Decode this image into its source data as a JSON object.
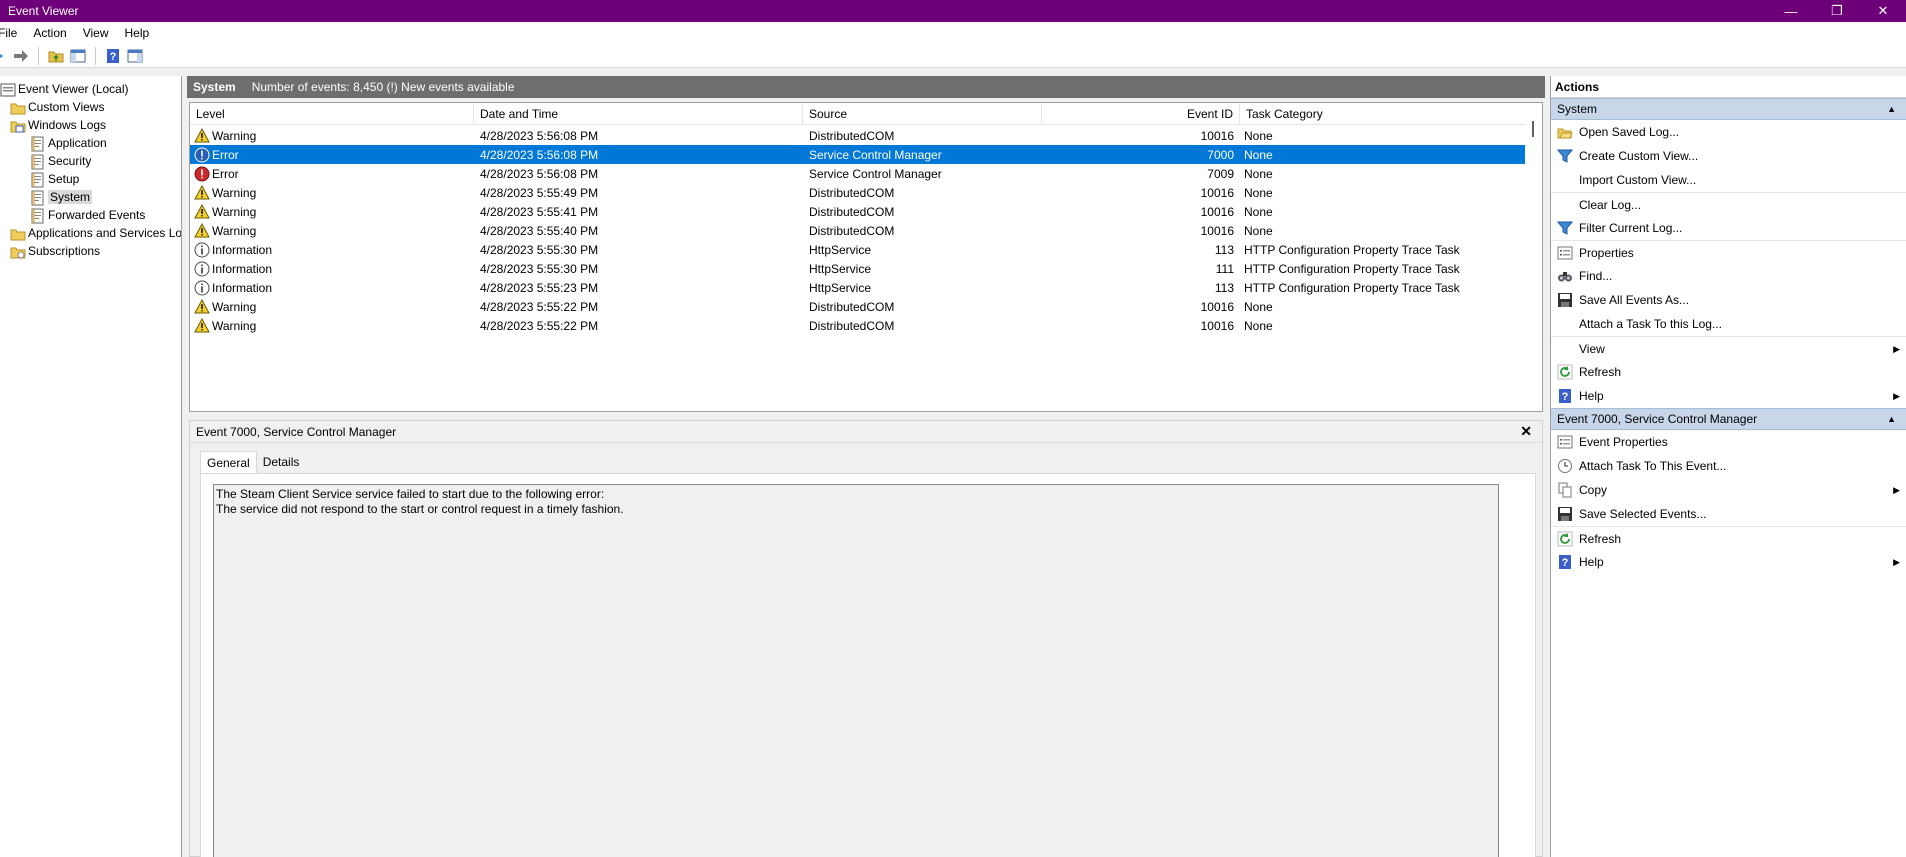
{
  "window": {
    "title": "Event Viewer",
    "min_glyph": "—",
    "max_glyph": "❐",
    "close_glyph": "✕"
  },
  "menu": [
    "File",
    "Action",
    "View",
    "Help"
  ],
  "tree": [
    {
      "label": "Event Viewer (Local)",
      "icon": "event-viewer-icon",
      "indent": 0
    },
    {
      "label": "Custom Views",
      "icon": "folder-icon",
      "indent": 1
    },
    {
      "label": "Windows Logs",
      "icon": "windows-logs-icon",
      "indent": 1
    },
    {
      "label": "Application",
      "icon": "log-icon",
      "indent": 2
    },
    {
      "label": "Security",
      "icon": "log-icon",
      "indent": 2
    },
    {
      "label": "Setup",
      "icon": "log-icon",
      "indent": 2
    },
    {
      "label": "System",
      "icon": "log-icon",
      "indent": 2,
      "selected": true
    },
    {
      "label": "Forwarded Events",
      "icon": "log-icon",
      "indent": 2
    },
    {
      "label": "Applications and Services Lo",
      "icon": "folder-icon",
      "indent": 1
    },
    {
      "label": "Subscriptions",
      "icon": "subscriptions-icon",
      "indent": 1
    }
  ],
  "log_header": {
    "title": "System",
    "info": "Number of events: 8,450 (!) New events available"
  },
  "columns": {
    "level": "Level",
    "date": "Date and Time",
    "source": "Source",
    "event_id": "Event ID",
    "task_category": "Task Category"
  },
  "events": [
    {
      "level": "Warning",
      "date": "4/28/2023 5:56:08 PM",
      "source": "DistributedCOM",
      "event_id": "10016",
      "category": "None"
    },
    {
      "level": "Error",
      "date": "4/28/2023 5:56:08 PM",
      "source": "Service Control Manager",
      "event_id": "7000",
      "category": "None",
      "selected": true
    },
    {
      "level": "Error",
      "date": "4/28/2023 5:56:08 PM",
      "source": "Service Control Manager",
      "event_id": "7009",
      "category": "None"
    },
    {
      "level": "Warning",
      "date": "4/28/2023 5:55:49 PM",
      "source": "DistributedCOM",
      "event_id": "10016",
      "category": "None"
    },
    {
      "level": "Warning",
      "date": "4/28/2023 5:55:41 PM",
      "source": "DistributedCOM",
      "event_id": "10016",
      "category": "None"
    },
    {
      "level": "Warning",
      "date": "4/28/2023 5:55:40 PM",
      "source": "DistributedCOM",
      "event_id": "10016",
      "category": "None"
    },
    {
      "level": "Information",
      "date": "4/28/2023 5:55:30 PM",
      "source": "HttpService",
      "event_id": "113",
      "category": "HTTP Configuration Property Trace Task"
    },
    {
      "level": "Information",
      "date": "4/28/2023 5:55:30 PM",
      "source": "HttpService",
      "event_id": "111",
      "category": "HTTP Configuration Property Trace Task"
    },
    {
      "level": "Information",
      "date": "4/28/2023 5:55:23 PM",
      "source": "HttpService",
      "event_id": "113",
      "category": "HTTP Configuration Property Trace Task"
    },
    {
      "level": "Warning",
      "date": "4/28/2023 5:55:22 PM",
      "source": "DistributedCOM",
      "event_id": "10016",
      "category": "None"
    },
    {
      "level": "Warning",
      "date": "4/28/2023 5:55:22 PM",
      "source": "DistributedCOM",
      "event_id": "10016",
      "category": "None"
    }
  ],
  "detail": {
    "title": "Event 7000, Service Control Manager",
    "close_glyph": "✕",
    "tabs": [
      "General",
      "Details"
    ],
    "description": [
      "The Steam Client Service service failed to start due to the following error:",
      "The service did not respond to the start or control request in a timely fashion."
    ]
  },
  "actions": {
    "title": "Actions",
    "sections": [
      {
        "title": "System",
        "items": [
          {
            "label": "Open Saved Log...",
            "icon": "open-folder-icon"
          },
          {
            "label": "Create Custom View...",
            "icon": "filter-icon"
          },
          {
            "label": "Import Custom View...",
            "icon": ""
          },
          {
            "label": "Clear Log...",
            "icon": "",
            "sep": true
          },
          {
            "label": "Filter Current Log...",
            "icon": "filter-icon"
          },
          {
            "label": "Properties",
            "icon": "properties-icon",
            "sep": true
          },
          {
            "label": "Find...",
            "icon": "binoculars-icon"
          },
          {
            "label": "Save All Events As...",
            "icon": "save-icon"
          },
          {
            "label": "Attach a Task To this Log...",
            "icon": ""
          },
          {
            "label": "View",
            "icon": "",
            "submenu": true,
            "sep": true
          },
          {
            "label": "Refresh",
            "icon": "refresh-icon"
          },
          {
            "label": "Help",
            "icon": "help-icon",
            "submenu": true
          }
        ]
      },
      {
        "title": "Event 7000, Service Control Manager",
        "items": [
          {
            "label": "Event Properties",
            "icon": "properties-icon"
          },
          {
            "label": "Attach Task To This Event...",
            "icon": "task-icon"
          },
          {
            "label": "Copy",
            "icon": "copy-icon",
            "submenu": true
          },
          {
            "label": "Save Selected Events...",
            "icon": "save-icon"
          },
          {
            "label": "Refresh",
            "icon": "refresh-icon",
            "sep": true
          },
          {
            "label": "Help",
            "icon": "help-icon",
            "submenu": true
          }
        ]
      }
    ]
  },
  "colors": {
    "titlebar": "#6d0078",
    "selection": "#0078d7",
    "section_header": "#c7d6e8",
    "log_header": "#6e6e6e"
  }
}
